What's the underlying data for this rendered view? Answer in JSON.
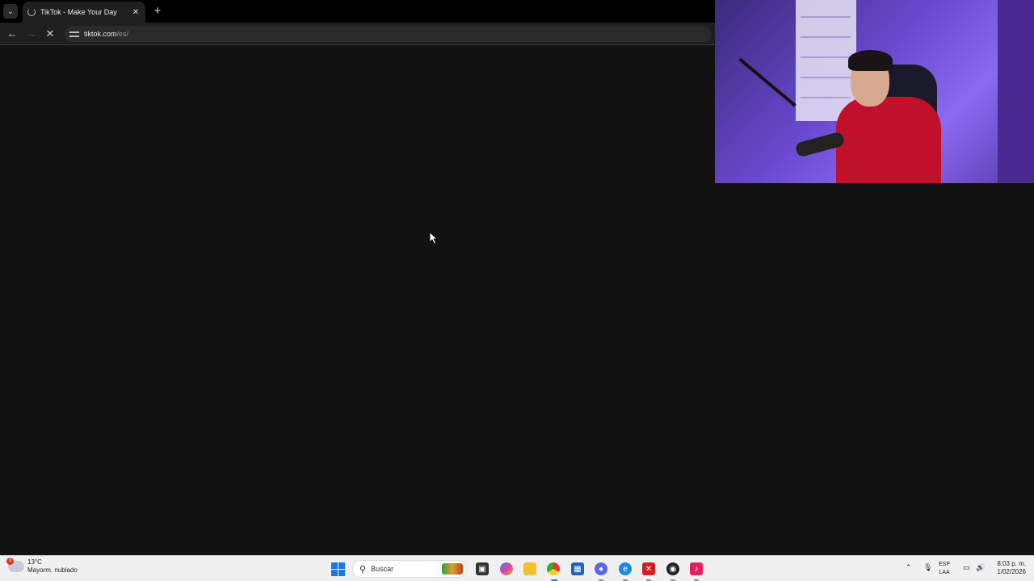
{
  "browser": {
    "tab_title": "TikTok - Make Your Day",
    "url_host": "tiktok.com",
    "url_path": "/es/",
    "icons": {
      "tab_menu": "chevron-down-icon",
      "close": "close-icon",
      "new_tab": "plus-icon",
      "back": "back-arrow-icon",
      "forward": "forward-arrow-icon",
      "stop": "stop-loading-icon",
      "site_info": "tune-icon"
    }
  },
  "taskbar": {
    "weather_temp": "13°C",
    "weather_desc": "Mayorm. nublado",
    "weather_badge": "3",
    "search_placeholder": "Buscar",
    "lang_line1": "ESP",
    "lang_line2": "LAA",
    "time": "8:03 p. m.",
    "date": "1/02/2026"
  }
}
